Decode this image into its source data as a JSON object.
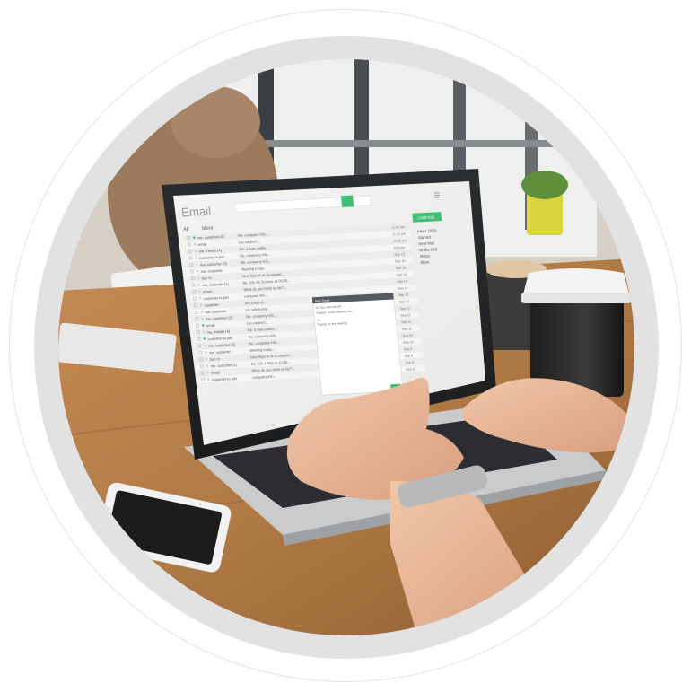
{
  "top_caption": "",
  "email_app": {
    "title": "Email",
    "filter_all": "All",
    "filter_more": "More",
    "compose_label": "COMPOSE",
    "folders": [
      "Inbox (263)",
      "Starred",
      "Sent Mail",
      "Drafts (26)",
      "Notes",
      "More"
    ],
    "rows": [
      {
        "sender": "me, customer (2)",
        "subject": "Re: company info...",
        "date": "11:41 pm"
      },
      {
        "sender": "email",
        "subject": "(no subject)...",
        "date": "11:12 pm"
      },
      {
        "sender": "me, friends (4)",
        "subject": "Re: 3 new outfits...",
        "date": "10:59 pm"
      },
      {
        "sender": "customer to join",
        "subject": "Re: company info...",
        "date": "9:40 pm"
      },
      {
        "sender": "me, customer (3)",
        "subject": "Re: company info...",
        "date": "Sep 15"
      },
      {
        "sender": "me, customer",
        "subject": "Meeting today...",
        "date": "Sep 15"
      },
      {
        "sender": "bon m",
        "subject": "New Sign-in at Computer...",
        "date": "Sep 15"
      },
      {
        "sender": "me, customer (1)",
        "subject": "Re: (On 22 October at 09:00...",
        "date": "Sep 14"
      },
      {
        "sender": "email",
        "subject": "What do you think so far?...",
        "date": "Sep 14"
      },
      {
        "sender": "customer to join",
        "subject": "company info...",
        "date": "Sep 14"
      },
      {
        "sender": "customer",
        "subject": "(no subject)...",
        "date": "Sep 13"
      },
      {
        "sender": "me, customer",
        "subject": "me with home...",
        "date": "Sep 13"
      },
      {
        "sender": "me, customer (2)",
        "subject": "Re: company info...",
        "date": "Sep 12"
      },
      {
        "sender": "email",
        "subject": "(no subject)...",
        "date": "Sep 12"
      },
      {
        "sender": "me, friends (4)",
        "subject": "Re: 3 new outfits...",
        "date": "Sep 11"
      },
      {
        "sender": "customer to join",
        "subject": "Re: company info...",
        "date": "Sep 11"
      },
      {
        "sender": "me, customer (3)",
        "subject": "Re: company info...",
        "date": "Sep 10"
      },
      {
        "sender": "me, customer",
        "subject": "Meeting today...",
        "date": "Sep 10"
      },
      {
        "sender": "bon m",
        "subject": "New Sign-in at Computer...",
        "date": "Sep 9"
      },
      {
        "sender": "me, customer (1)",
        "subject": "Re: (On 1 Sep at 11:00...",
        "date": "Sep 9"
      },
      {
        "sender": "email",
        "subject": "What do you think so far?...",
        "date": "Sep 8"
      },
      {
        "sender": "customer to join",
        "subject": "company info...",
        "date": "Sep 8"
      }
    ],
    "popup": {
      "header": "New Email",
      "to_line": "To:  the customer (4)",
      "subject_line": "Subject:  Some meeting info...",
      "greeting": "Hi,",
      "body": "Thanks for the meeting!"
    }
  },
  "colors": {
    "accent_green": "#3fbf73",
    "ring_gray": "#e2e2e2",
    "table_wood": "#b07a45"
  }
}
